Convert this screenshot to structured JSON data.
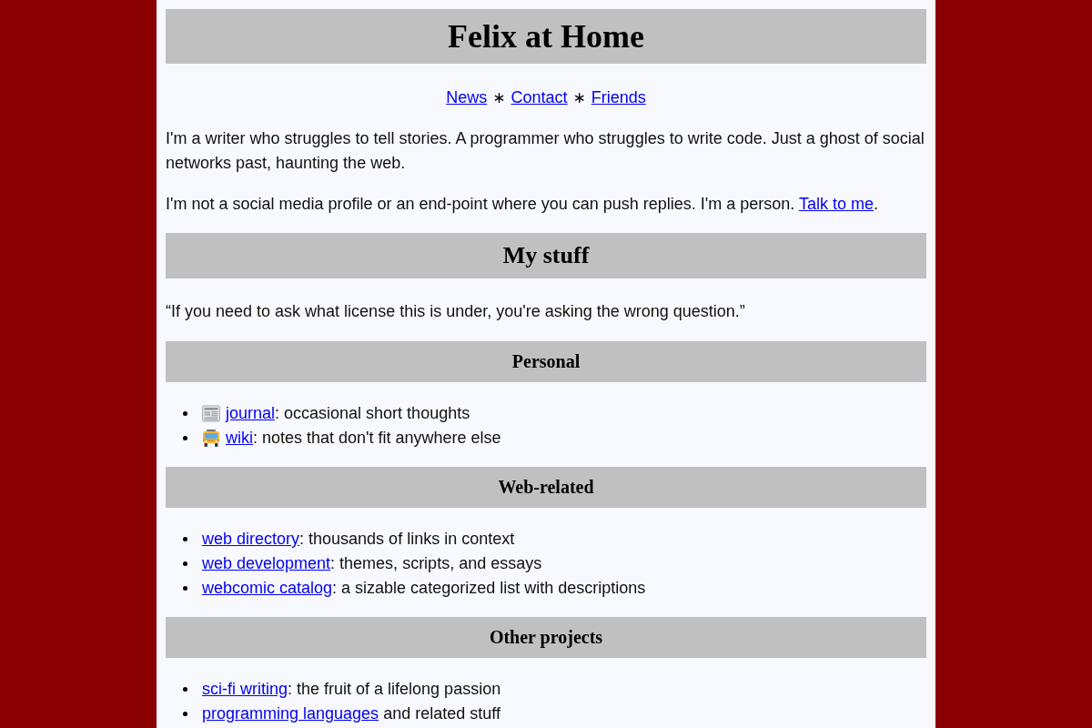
{
  "header": {
    "title": "Felix at Home"
  },
  "nav": [
    {
      "kind": "link",
      "text": "News"
    },
    {
      "kind": "separator",
      "text": "∗"
    },
    {
      "kind": "link",
      "text": "Contact"
    },
    {
      "kind": "separator",
      "text": "∗"
    },
    {
      "kind": "link",
      "text": "Friends"
    }
  ],
  "intro": [
    {
      "text": "I'm a writer who struggles to tell stories. A programmer who struggles to write code. Just a ghost of social networks past, haunting the web."
    },
    {
      "text": "I'm not a social media profile or an end-point where you can push replies. I'm a person. ",
      "link": "Talk to me",
      "after": "."
    }
  ],
  "my_stuff": {
    "title": "My stuff",
    "quote": "“If you need to ask what license this is under, you're asking the wrong question.”",
    "groups": [
      {
        "title": "Personal",
        "items": [
          {
            "kind": "newspaper",
            "link": "journal",
            "text": ": occasional short thoughts"
          },
          {
            "kind": "bus",
            "link": "wiki",
            "text": ": notes that don't fit anywhere else"
          }
        ]
      },
      {
        "title": "Web-related",
        "items": [
          {
            "kind": "plain",
            "link": "web directory",
            "text": ": thousands of links in context"
          },
          {
            "kind": "plain",
            "link": "web development",
            "text": ": themes, scripts, and essays"
          },
          {
            "kind": "plain",
            "link": "webcomic catalog",
            "text": ": a sizable categorized list with descriptions"
          }
        ]
      },
      {
        "title": "Other projects",
        "items": [
          {
            "kind": "plain",
            "link": "sci-fi writing",
            "text": ": the fruit of a lifelong passion"
          },
          {
            "kind": "plain",
            "link": "programming languages",
            "text": " and related stuff"
          }
        ]
      }
    ]
  }
}
